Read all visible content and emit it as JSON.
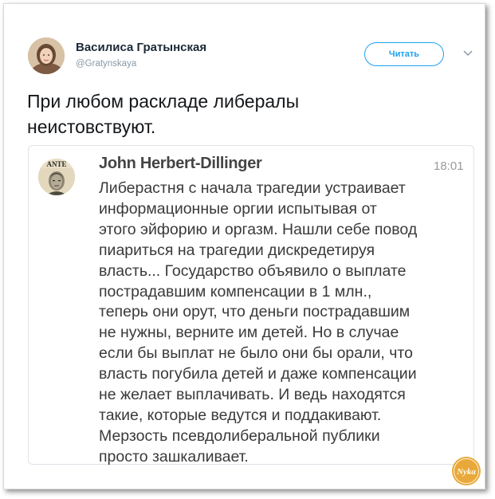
{
  "tweet": {
    "author_name": "Василиса Гратынская",
    "author_handle": "@Gratynskaya",
    "follow_label": "Читать",
    "text_lines": [
      "При любом раскладе либералы",
      "неистовствуют."
    ]
  },
  "quoted_message": {
    "author_name": "John Herbert-Dillinger",
    "time": "18:01",
    "avatar_caption": "ANTE",
    "body_lines": [
      "Либерастня  с начала трагедии устраивает",
      "информационные оргии испытывая от",
      "этого эйфорию и оргазм. Нашли себе повод",
      "пиариться на трагедии дискредетируя",
      "власть... Государство объявило о выплате",
      "пострадавшим компенсации в 1 млн.,",
      "теперь они орут, что деньги пострадавшим",
      "не нужны, верните им детей. Но в случае",
      "если бы выплат не было они бы орали, что",
      "власть погубила детей и даже компенсации",
      "не желает выплачивать. И ведь находятся",
      "такие, которые ведутся и поддакивают.",
      "Мерзость псевдолиберальной публики",
      "просто зашкаливает."
    ]
  },
  "watermark_text": "Nyka",
  "colors": {
    "accent": "#1da1f2",
    "name_text": "#1c2938",
    "muted_text": "#8899a6",
    "watermark": "#e8a83a"
  }
}
